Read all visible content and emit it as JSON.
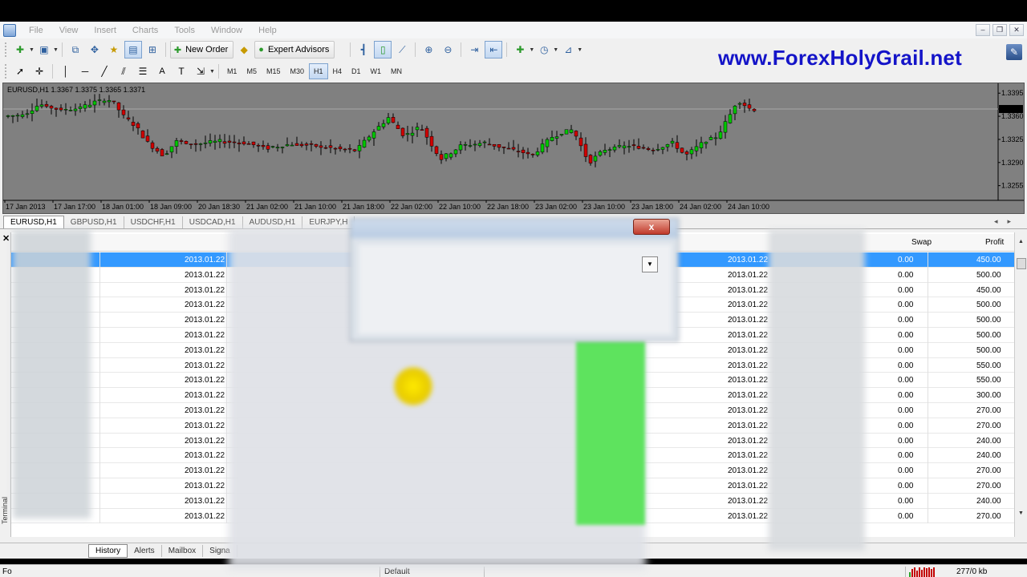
{
  "menu": [
    "File",
    "View",
    "Insert",
    "Charts",
    "Tools",
    "Window",
    "Help"
  ],
  "toolbar": {
    "new_order_label": "New Order",
    "expert_advisors_label": "Expert Advisors",
    "timeframes": [
      "M1",
      "M5",
      "M15",
      "M30",
      "H1",
      "H4",
      "D1",
      "W1",
      "MN"
    ],
    "active_timeframe": "H1"
  },
  "brand_text": "www.ForexHolyGrail.net",
  "chart": {
    "header": "EURUSD,H1  1.3367 1.3375 1.3365 1.3371",
    "price_labels": [
      "1.3395",
      "1.3371",
      "1.3360",
      "1.3325",
      "1.3290",
      "1.3255"
    ],
    "current_price": "1.3371",
    "time_labels": [
      "17 Jan 2013",
      "17 Jan 17:00",
      "18 Jan 01:00",
      "18 Jan 09:00",
      "20 Jan 18:30",
      "21 Jan 02:00",
      "21 Jan 10:00",
      "21 Jan 18:00",
      "22 Jan 02:00",
      "22 Jan 10:00",
      "22 Jan 18:00",
      "23 Jan 02:00",
      "23 Jan 10:00",
      "23 Jan 18:00",
      "24 Jan 02:00",
      "24 Jan 10:00"
    ],
    "colors": {
      "background": "#808080",
      "bull": "#00c800",
      "bear": "#d00000"
    }
  },
  "chart_tabs": [
    "EURUSD,H1",
    "GBPUSD,H1",
    "USDCHF,H1",
    "USDCAD,H1",
    "AUDUSD,H1",
    "EURJPY,H"
  ],
  "terminal": {
    "columns": {
      "swap": "Swap",
      "profit": "Profit"
    },
    "side_label": "Terminal",
    "rows": [
      {
        "open_date": "2013.01.22",
        "close_date": "2013.01.22",
        "swap": "0.00",
        "profit": "450.00"
      },
      {
        "open_date": "2013.01.22",
        "close_date": "2013.01.22",
        "swap": "0.00",
        "profit": "500.00"
      },
      {
        "open_date": "2013.01.22",
        "close_date": "2013.01.22",
        "swap": "0.00",
        "profit": "450.00"
      },
      {
        "open_date": "2013.01.22",
        "close_date": "2013.01.22",
        "swap": "0.00",
        "profit": "500.00"
      },
      {
        "open_date": "2013.01.22",
        "close_date": "2013.01.22",
        "swap": "0.00",
        "profit": "500.00"
      },
      {
        "open_date": "2013.01.22",
        "close_date": "2013.01.22",
        "swap": "0.00",
        "profit": "500.00"
      },
      {
        "open_date": "2013.01.22",
        "close_date": "2013.01.22",
        "swap": "0.00",
        "profit": "500.00"
      },
      {
        "open_date": "2013.01.22",
        "close_date": "2013.01.22",
        "swap": "0.00",
        "profit": "550.00"
      },
      {
        "open_date": "2013.01.22",
        "close_date": "2013.01.22",
        "swap": "0.00",
        "profit": "550.00"
      },
      {
        "open_date": "2013.01.22",
        "close_date": "2013.01.22",
        "swap": "0.00",
        "profit": "300.00"
      },
      {
        "open_date": "2013.01.22",
        "close_date": "2013.01.22",
        "swap": "0.00",
        "profit": "270.00"
      },
      {
        "open_date": "2013.01.22",
        "close_date": "2013.01.22",
        "swap": "0.00",
        "profit": "270.00"
      },
      {
        "open_date": "2013.01.22",
        "close_date": "2013.01.22",
        "swap": "0.00",
        "profit": "240.00"
      },
      {
        "open_date": "2013.01.22",
        "close_date": "2013.01.22",
        "swap": "0.00",
        "profit": "240.00"
      },
      {
        "open_date": "2013.01.22",
        "close_date": "2013.01.22",
        "swap": "0.00",
        "profit": "270.00"
      },
      {
        "open_date": "2013.01.22",
        "close_date": "2013.01.22",
        "swap": "0.00",
        "profit": "270.00"
      },
      {
        "open_date": "2013.01.22",
        "close_date": "2013.01.22",
        "swap": "0.00",
        "profit": "240.00"
      },
      {
        "open_date": "2013.01.22",
        "close_date": "2013.01.22",
        "swap": "0.00",
        "profit": "270.00"
      }
    ]
  },
  "bottom_tabs": [
    "History",
    "Alerts",
    "Mailbox",
    "Signa"
  ],
  "dialog": {
    "close_label": "x"
  },
  "status": {
    "left": "Fo",
    "profile": "Default",
    "traffic": "277/0 kb"
  }
}
